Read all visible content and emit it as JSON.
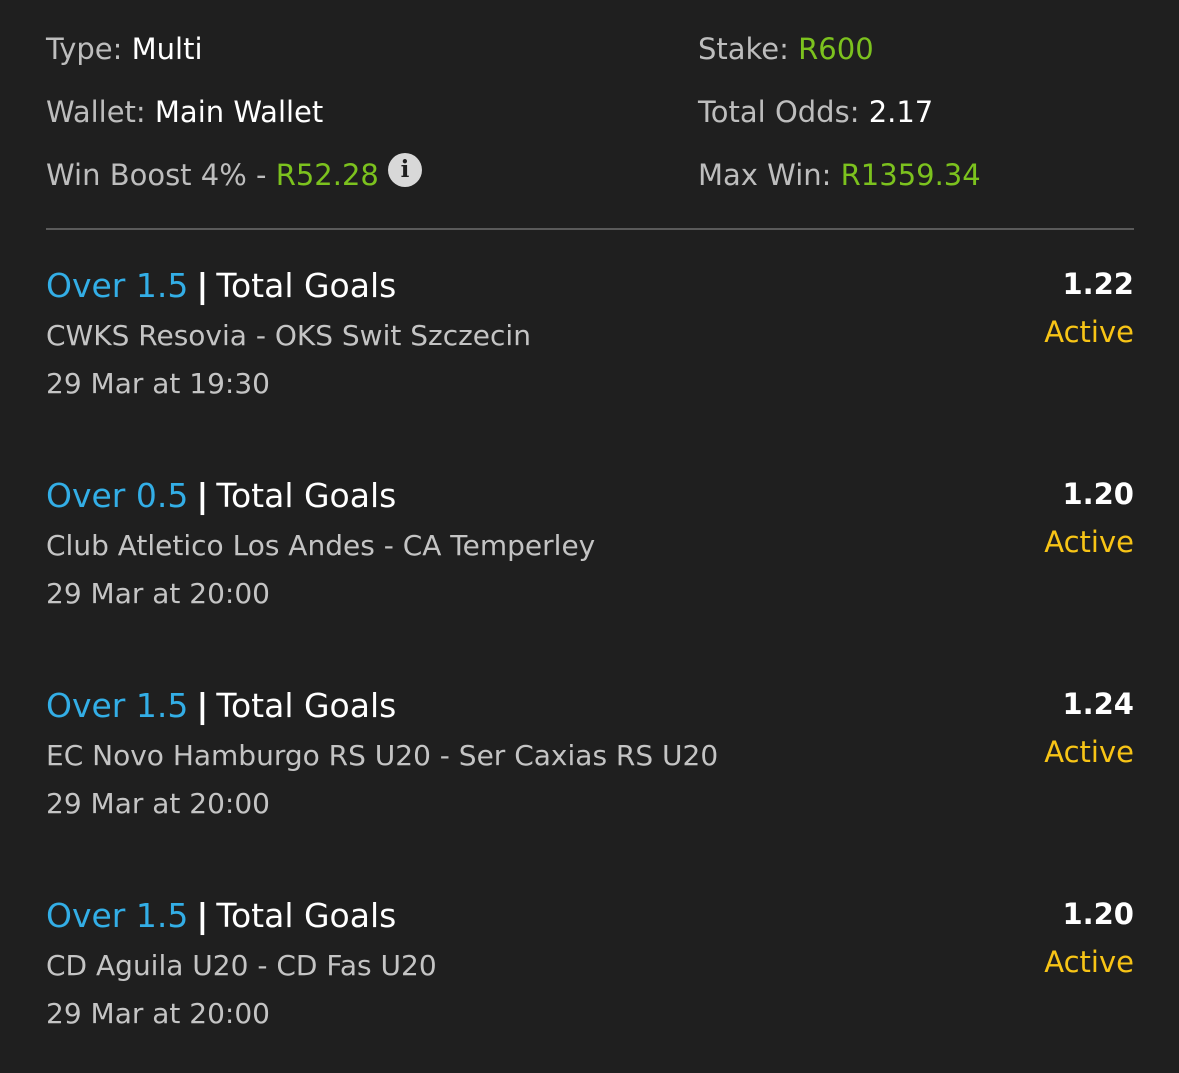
{
  "summary": {
    "type_label": "Type:",
    "type_value": "Multi",
    "wallet_label": "Wallet:",
    "wallet_value": "Main Wallet",
    "boost_label": "Win Boost 4% -",
    "boost_value": "R52.28",
    "info_icon": "info-icon",
    "stake_label": "Stake:",
    "stake_value": "R600",
    "odds_label": "Total Odds:",
    "odds_value": "2.17",
    "maxwin_label": "Max Win:",
    "maxwin_value": "R1359.34"
  },
  "legs": [
    {
      "selection": "Over 1.5",
      "separator": "|",
      "market": "Total Goals",
      "match": "CWKS Resovia - OKS Swit Szczecin",
      "date": "29 Mar at 19:30",
      "odds": "1.22",
      "status": "Active"
    },
    {
      "selection": "Over 0.5",
      "separator": "|",
      "market": "Total Goals",
      "match": "Club Atletico Los Andes - CA Temperley",
      "date": "29 Mar at 20:00",
      "odds": "1.20",
      "status": "Active"
    },
    {
      "selection": "Over 1.5",
      "separator": "|",
      "market": "Total Goals",
      "match": "EC Novo Hamburgo RS U20 - Ser Caxias RS U20",
      "date": "29 Mar at 20:00",
      "odds": "1.24",
      "status": "Active"
    },
    {
      "selection": "Over 1.5",
      "separator": "|",
      "market": "Total Goals",
      "match": "CD Aguila U20 - CD Fas U20",
      "date": "29 Mar at 20:00",
      "odds": "1.20",
      "status": "Active"
    }
  ],
  "colors": {
    "background": "#1f1f1f",
    "selection": "#33aee6",
    "money": "#7cc21e",
    "status_active": "#f7c416"
  }
}
